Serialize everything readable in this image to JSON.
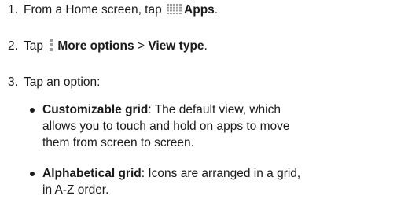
{
  "steps": [
    {
      "number": "1.",
      "text_before": "From a Home screen, tap",
      "bold": "Apps",
      "text_after": "."
    },
    {
      "number": "2.",
      "text_before": "Tap",
      "bold1": "More options",
      "sep": ">",
      "bold2": "View type",
      "text_after": "."
    },
    {
      "number": "3.",
      "text": "Tap an option:"
    }
  ],
  "options": [
    {
      "term": "Customizable grid",
      "line1": ": The default view, which",
      "line2": "allows you to touch and hold on apps to move",
      "line3": "them from screen to screen."
    },
    {
      "term": "Alphabetical grid",
      "line1": ": Icons are arranged in a grid,",
      "line2": "in A-Z order."
    }
  ],
  "icons": {
    "apps": "apps-grid-icon",
    "more": "more-options-icon"
  },
  "colors": {
    "text": "#1a1a1a",
    "icon": "#9a9a9a"
  }
}
